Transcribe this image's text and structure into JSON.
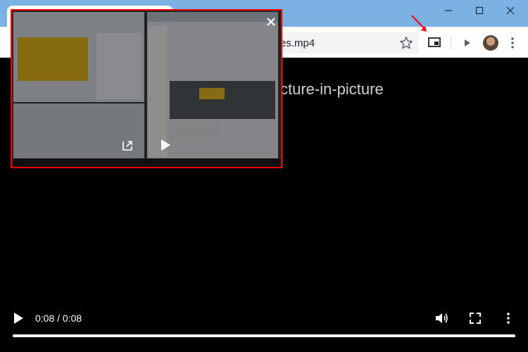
{
  "browser": {
    "url_text": "es.mp4",
    "window_controls": [
      "minimize",
      "maximize",
      "close"
    ]
  },
  "page": {
    "heading": "cture-in-picture"
  },
  "pip_window": {
    "icons": [
      "close-icon",
      "back-to-tab-icon",
      "play-icon"
    ],
    "highlight_color": "#ff0000"
  },
  "player": {
    "time": "0:08 / 0:08",
    "progress_fraction": 1.0
  },
  "colors": {
    "titlebar": "#7cb1e3",
    "annotation_red": "#ff0000"
  }
}
